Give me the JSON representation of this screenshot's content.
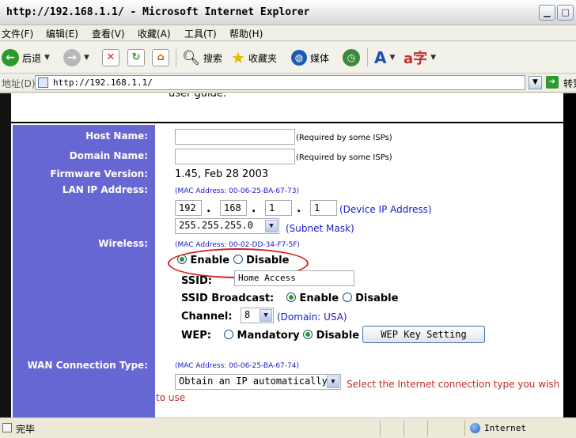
{
  "window": {
    "title": "http://192.168.1.1/ - Microsoft Internet Explorer"
  },
  "menu": [
    "文件(F)",
    "编辑(E)",
    "查看(V)",
    "收藏(A)",
    "工具(T)",
    "帮助(H)"
  ],
  "toolbar": {
    "back": "后退",
    "search": "搜索",
    "favorites": "收藏夹",
    "media": "媒体"
  },
  "address": {
    "label": "地址(D)",
    "url": "http://192.168.1.1/",
    "go": "转到"
  },
  "page": {
    "top_text": "user guide.",
    "labels": {
      "host_name": "Host Name:",
      "domain_name": "Domain Name:",
      "firmware": "Firmware Version:",
      "lan_ip": "LAN IP Address:",
      "wireless": "Wireless:",
      "wan_type": "WAN Connection Type:"
    },
    "host_name": {
      "value": "",
      "note": "(Required by some ISPs)"
    },
    "domain_name": {
      "value": "",
      "note": "(Required by some ISPs)"
    },
    "firmware_value": "1.45, Feb 28 2003",
    "lan": {
      "mac": "(MAC Address: 00-06-25-BA-67-73)",
      "ip": [
        "192",
        "168",
        "1",
        "1"
      ],
      "ip_note": "(Device IP Address)",
      "subnet": "255.255.255.0",
      "subnet_note": "(Subnet Mask)"
    },
    "wireless": {
      "mac": "(MAC Address: 00-02-DD-34-F7-5F)",
      "enable": "Enable",
      "disable": "Disable",
      "ssid_label": "SSID:",
      "ssid_value": "Home Access",
      "broadcast_label": "SSID Broadcast:",
      "broadcast_enable": "Enable",
      "broadcast_disable": "Disable",
      "channel_label": "Channel:",
      "channel_value": "8",
      "channel_note": "(Domain: USA)",
      "wep_label": "WEP:",
      "wep_mandatory": "Mandatory",
      "wep_disable": "Disable",
      "wep_button": "WEP Key Setting"
    },
    "wan": {
      "mac": "(MAC Address: 00-06-25-BA-67-74)",
      "type_value": "Obtain an IP automatically",
      "hint_line1": "Select the Internet connection type you wish",
      "hint_line2": "to use"
    }
  },
  "status": {
    "text": "完毕",
    "zone": "Internet"
  },
  "colors": {
    "sidebar": "#6767d4",
    "highlight": "#d42020",
    "hint": "#c02a2a",
    "note_blue": "#1a1acc"
  }
}
